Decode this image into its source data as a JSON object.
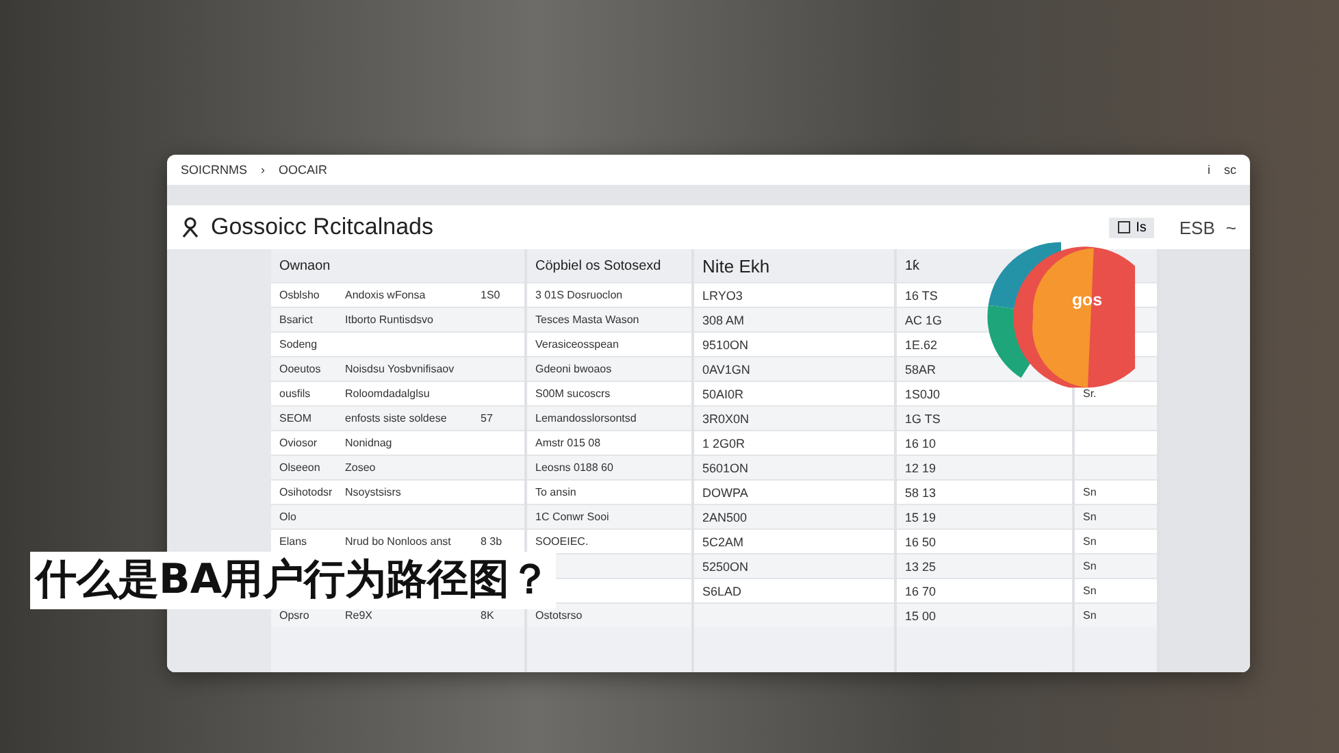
{
  "caption": "什么是BA用户行为路径图？",
  "window": {
    "breadcrumb": [
      "SOICRNMS",
      "›",
      "OOCAIR"
    ],
    "controls": [
      "i",
      "sc"
    ]
  },
  "header": {
    "title": "Gossoicc Rcitcalnads",
    "button_label": "Is",
    "right_labels": [
      "ESB",
      "~"
    ]
  },
  "pie_label": "gos",
  "table": {
    "columns": [
      "Ownaon",
      "",
      "",
      "Cöpbiel os Sotosexd",
      "Nite Ekh",
      "1ƙ",
      ""
    ],
    "rows": [
      [
        "Osblsho",
        "Andoxis   wFonsa",
        "1S0",
        "3 01S Dosruoclon",
        "LRYO3",
        "16 TS",
        ""
      ],
      [
        "Bsarict",
        "Itborto Runtisdsvo",
        "",
        "Tesces Masta Wason",
        "308 AM",
        "AC 1G",
        ""
      ],
      [
        "Sodeng",
        "",
        "",
        "Verasiceosspean",
        "9510ON",
        "1E.62",
        ""
      ],
      [
        "Ooeutos",
        "Noisdsu   Yosbvnifisaov",
        "",
        "Gdeoni   bwoaos",
        "0AV1GN",
        "58AR",
        ""
      ],
      [
        "ousfils",
        "Roloomdadalglsu",
        "",
        "S00M   sucoscrs",
        "50AI0R",
        "1S0J0",
        "Sr."
      ],
      [
        "SEOM",
        "enfosts siste soldese",
        "57",
        "Lemandosslorsontsd",
        "3R0X0N",
        "1G TS",
        ""
      ],
      [
        "Oviosor",
        "Nonidnag",
        "",
        "Amstr   015   08",
        "1 2G0R",
        "16 10",
        ""
      ],
      [
        "Olseeon",
        "Zoseo",
        "",
        "Leosns   0188  60",
        "5601ON",
        "12 19",
        ""
      ],
      [
        "Osihotodsr",
        "Nsoystsisrs",
        "",
        "To ansin",
        "DOWPA",
        "58 13",
        "Sn"
      ],
      [
        "Olo",
        "",
        "",
        "1C Conwr Sooi",
        "2AN500",
        "15 19",
        "Sn"
      ],
      [
        "Elans",
        "Nrud bo Nonloos anst",
        "8 3b",
        "SOOEIEC.",
        "5C2AM",
        "16 50",
        "Sn"
      ],
      [
        "",
        "",
        "",
        "",
        "5250ON",
        "13 25",
        "Sn"
      ],
      [
        "",
        "",
        "",
        "",
        "S6LAD",
        "16 70",
        "Sn"
      ],
      [
        "Opsro",
        "Re9X",
        "8K",
        "Ostotsrso",
        "",
        "15 00",
        "Sn"
      ]
    ]
  }
}
